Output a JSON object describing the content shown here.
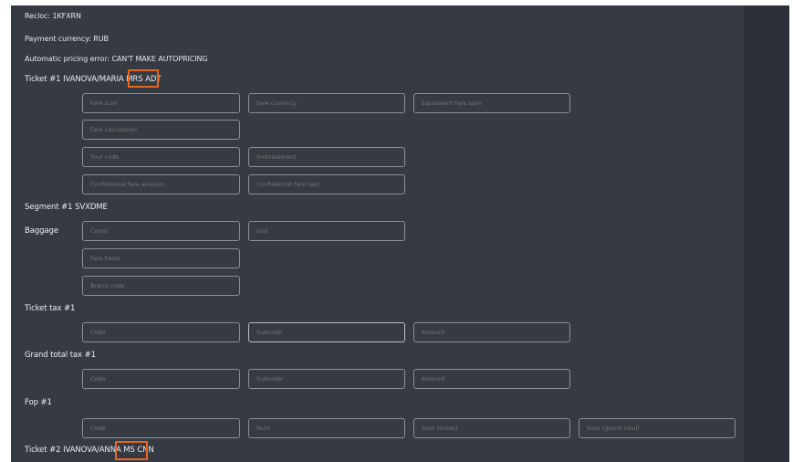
{
  "header": {
    "recloc": "Recloc: 1KFXRN",
    "payment_currency": "Payment currency: RUB",
    "pricing_error": "Automatic pricing error: CAN'T MAKE AUTOPRICING"
  },
  "ticket1": {
    "title_prefix": "Ticket #1 IVANOVA/MARIA MRS",
    "pax_type": "ADT",
    "fields": {
      "fare_sum": "Fare sum",
      "fare_currency": "Fare currency",
      "equivalent_fare_sum": "Equivalent fare sum",
      "fare_calculation": "Fare calculation",
      "tour_code": "Tour code",
      "endorsement": "Endorsement",
      "confidential_fare_amount": "Confidential fare amount",
      "confidential_fare_text": "Confidential fare text"
    }
  },
  "segment1": {
    "title": "Segment #1 SVXDME",
    "baggage_label": "Baggage",
    "fields": {
      "count": "Count",
      "unit": "Unit",
      "fare_basis": "Fare basis",
      "brand_code": "Brand code"
    }
  },
  "ticket_tax": {
    "title": "Ticket tax #1",
    "fields": {
      "code": "Code",
      "subcode": "Subcode",
      "amount": "Amount"
    }
  },
  "grand_total_tax": {
    "title": "Grand total tax #1",
    "fields": {
      "code": "Code",
      "subcode": "Subcode",
      "amount": "Amount"
    }
  },
  "fop": {
    "title": "Fop #1",
    "fields": {
      "code": "Code",
      "num": "Num",
      "sum_ticket": "Sum (ticket)",
      "sum_grand_total": "Sum (grand total)"
    }
  },
  "ticket2": {
    "title_prefix": "Ticket #2 IVANOVA/ANNA MS",
    "pax_type": "CNN"
  },
  "colors": {
    "highlight": "#e8661f",
    "background": "#363a42"
  }
}
